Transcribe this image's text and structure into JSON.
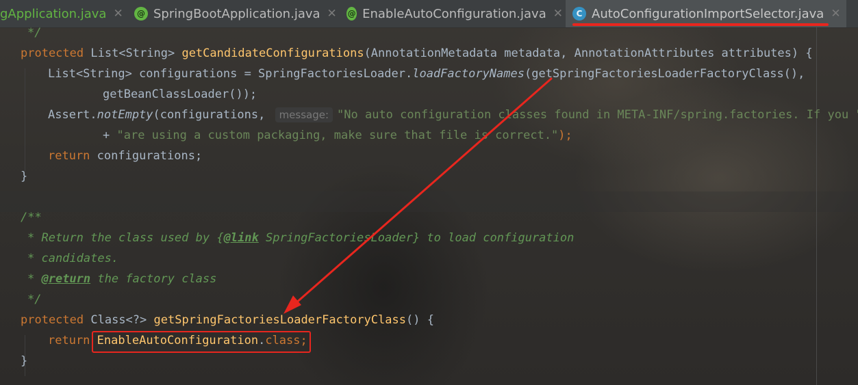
{
  "tabs": [
    {
      "label": "gApplication.java",
      "icon": "none",
      "active": false
    },
    {
      "label": "SpringBootApplication.java",
      "icon": "annotation-icon",
      "active": false
    },
    {
      "label": "EnableAutoConfiguration.java",
      "icon": "annotation-icon",
      "active": false
    },
    {
      "label": "AutoConfigurationImportSelector.java",
      "icon": "class-icon",
      "active": true
    }
  ],
  "tab_icon_glyphs": {
    "annotation": "@",
    "class": "C"
  },
  "tab_close_glyph": "✕",
  "colors": {
    "keyword": "#cc7832",
    "method": "#ffc66d",
    "string": "#6a8759",
    "comment": "#629755",
    "plain": "#a9b7c6",
    "annotation_red": "#e8261e"
  },
  "code": {
    "l0": "*/",
    "l1_protected": "protected",
    "l1_type": "List<String>",
    "l1_method": "getCandidateConfigurations",
    "l1_params": "(AnnotationMetadata metadata, AnnotationAttributes attributes) {",
    "l2_pre": "List<String> configurations = SpringFactoriesLoader.",
    "l2_call": "loadFactoryNames",
    "l2_post": "(getSpringFactoriesLoaderFactoryClass(),",
    "l3": "getBeanClassLoader());",
    "l4_pre": "Assert.",
    "l4_call": "notEmpty",
    "l4_args": "(configurations,",
    "l4_hint": "message:",
    "l4_str": "\"No auto configuration classes found in META-INF/spring.factories. If you \"",
    "l5_plus": "+",
    "l5_str": "\"are using a custom packaging, make sure that file is correct.\"",
    "l5_end": ");",
    "l6_return": "return",
    "l6_rest": "configurations;",
    "l7": "}",
    "l9": "/**",
    "l10_a": "* Return the class used by {",
    "l10_tag": "@link",
    "l10_b": " SpringFactoriesLoader} to load configuration",
    "l11": "* candidates.",
    "l12_a": "* ",
    "l12_tag": "@return",
    "l12_b": " the factory class",
    "l13": "*/",
    "l14_protected": "protected",
    "l14_type": "Class<?>",
    "l14_method": "getSpringFactoriesLoaderFactoryClass",
    "l14_rest": "() {",
    "l15_return": "return",
    "l15_class": "EnableAutoConfiguration",
    "l15_dot": ".",
    "l15_kw": "class",
    "l15_semi": ";",
    "l16": "}"
  }
}
